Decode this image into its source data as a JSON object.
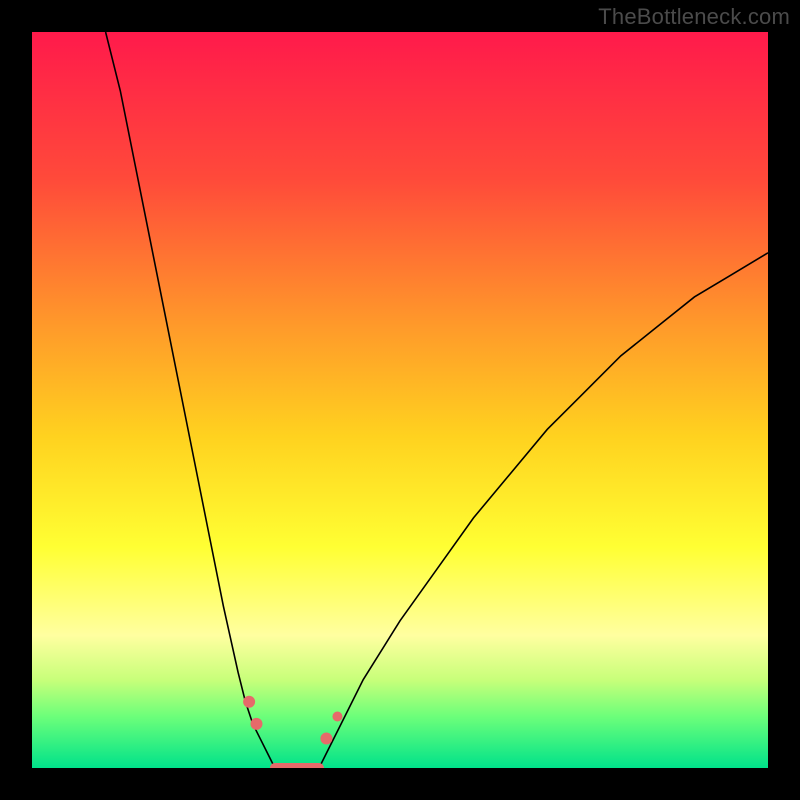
{
  "watermark": "TheBottleneck.com",
  "chart_data": {
    "type": "line",
    "title": "",
    "xlabel": "",
    "ylabel": "",
    "xlim": [
      0,
      100
    ],
    "ylim": [
      0,
      100
    ],
    "grid": false,
    "legend": false,
    "background": {
      "type": "vertical-gradient",
      "stops": [
        {
          "pos": 0,
          "color": "#ff1a4b"
        },
        {
          "pos": 20,
          "color": "#ff4a3a"
        },
        {
          "pos": 40,
          "color": "#ff9a2a"
        },
        {
          "pos": 55,
          "color": "#ffd21f"
        },
        {
          "pos": 70,
          "color": "#ffff33"
        },
        {
          "pos": 82,
          "color": "#ffffa0"
        },
        {
          "pos": 88,
          "color": "#c8ff7a"
        },
        {
          "pos": 93,
          "color": "#6cff7a"
        },
        {
          "pos": 100,
          "color": "#00e28a"
        }
      ]
    },
    "series": [
      {
        "name": "left-branch",
        "stroke": "#000000",
        "width": 1.6,
        "x": [
          10,
          12,
          14,
          16,
          18,
          20,
          22,
          24,
          26,
          28,
          29,
          30,
          31,
          32,
          33
        ],
        "y": [
          100,
          92,
          82,
          72,
          62,
          52,
          42,
          32,
          22,
          13,
          9,
          6,
          4,
          2,
          0
        ]
      },
      {
        "name": "right-branch",
        "stroke": "#000000",
        "width": 1.6,
        "x": [
          39,
          40,
          42,
          45,
          50,
          55,
          60,
          65,
          70,
          75,
          80,
          85,
          90,
          95,
          100
        ],
        "y": [
          0,
          2,
          6,
          12,
          20,
          27,
          34,
          40,
          46,
          51,
          56,
          60,
          64,
          67,
          70
        ]
      },
      {
        "name": "valley-floor",
        "stroke": "#e66a6a",
        "width": 10,
        "linecap": "round",
        "x": [
          33,
          34,
          35,
          36,
          37,
          38,
          39
        ],
        "y": [
          0,
          0,
          0,
          0,
          0,
          0,
          0
        ]
      }
    ],
    "markers": [
      {
        "name": "left-dot-1",
        "x": 29.5,
        "y": 9,
        "r": 6,
        "color": "#e66a6a"
      },
      {
        "name": "left-dot-2",
        "x": 30.5,
        "y": 6,
        "r": 6,
        "color": "#e66a6a"
      },
      {
        "name": "right-dot-1",
        "x": 40,
        "y": 4,
        "r": 6,
        "color": "#e66a6a"
      },
      {
        "name": "right-dot-2",
        "x": 41.5,
        "y": 7,
        "r": 5,
        "color": "#e66a6a"
      }
    ]
  }
}
